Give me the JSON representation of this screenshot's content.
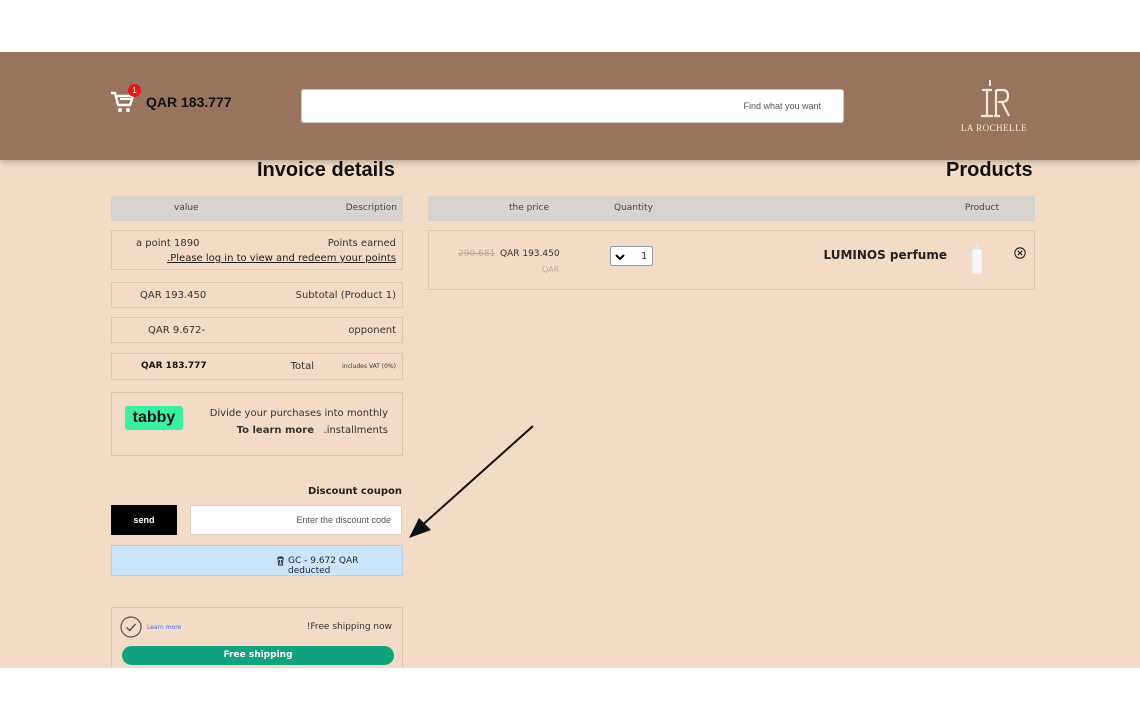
{
  "header": {
    "cart_badge": "1",
    "cart_total": "QAR 183.777",
    "search_placeholder": "Find what you want",
    "logo_text": "LA ROCHELLE"
  },
  "invoice": {
    "title": "Invoice details",
    "col_value": "value",
    "col_description": "Description",
    "points_value": "a point 1890",
    "points_label": "Points earned",
    "points_link": ".Please log in to view and redeem your points",
    "subtotal_value": "QAR 193.450",
    "subtotal_label": "Subtotal (Product 1)",
    "opponent_value": "QAR 9.672-",
    "opponent_label": "opponent",
    "total_value": "QAR 183.777",
    "total_label": "Total",
    "vat_note": "includes VAT (0%)"
  },
  "tabby": {
    "logo": "tabby",
    "line1": "Divide your purchases into monthly",
    "learn_more": "To learn more",
    "line2_rest": ".installments"
  },
  "coupon": {
    "title": "Discount coupon",
    "send_label": "send",
    "placeholder": "Enter the discount code",
    "deducted_text": "GC - 9.672 QAR deducted"
  },
  "shipping": {
    "learn_more": "Learn more",
    "status": "!Free shipping now",
    "button": "Free shipping"
  },
  "products": {
    "title": "Products",
    "col_price": "the price",
    "col_quantity": "Quantity",
    "col_product": "Product",
    "items": [
      {
        "old_price": "290.681",
        "price": "QAR 193.450",
        "currency_note": "QAR",
        "quantity": "1",
        "name": "LUMINOS perfume"
      }
    ]
  }
}
